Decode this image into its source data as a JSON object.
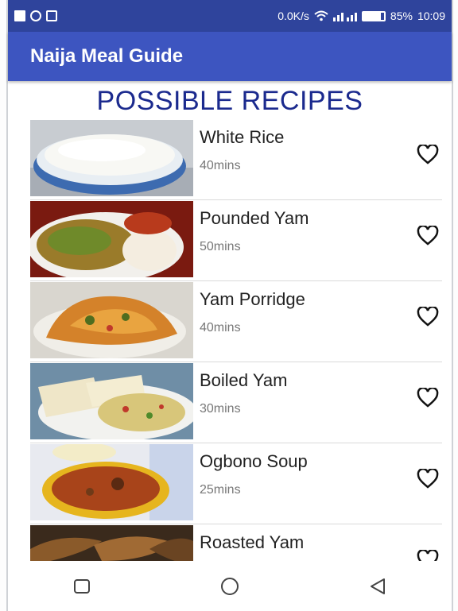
{
  "colors": {
    "statusbar": "#2f449c",
    "appbar": "#3d55c0",
    "heading": "#1b2a8e"
  },
  "status_bar": {
    "left_icons": [
      "facebook-icon",
      "whatsapp-icon",
      "message-icon"
    ],
    "network_speed": "0.0K/s",
    "battery_level": 0.85,
    "battery_text": "85%",
    "time": "10:09"
  },
  "app_bar": {
    "title": "Naija Meal Guide"
  },
  "page": {
    "heading": "POSSIBLE RECIPES"
  },
  "recipes": [
    {
      "name": "White Rice",
      "time": "40mins",
      "icon": "heart-outline-icon"
    },
    {
      "name": "Pounded Yam",
      "time": "50mins",
      "icon": "heart-outline-icon"
    },
    {
      "name": "Yam Porridge",
      "time": "40mins",
      "icon": "heart-outline-icon"
    },
    {
      "name": "Boiled Yam",
      "time": "30mins",
      "icon": "heart-outline-icon"
    },
    {
      "name": "Ogbono Soup",
      "time": "25mins",
      "icon": "heart-outline-icon"
    },
    {
      "name": "Roasted Yam",
      "time": "",
      "icon": "heart-outline-icon"
    }
  ],
  "nav_bar": {
    "buttons": [
      "recents-icon",
      "home-icon",
      "back-icon"
    ]
  }
}
